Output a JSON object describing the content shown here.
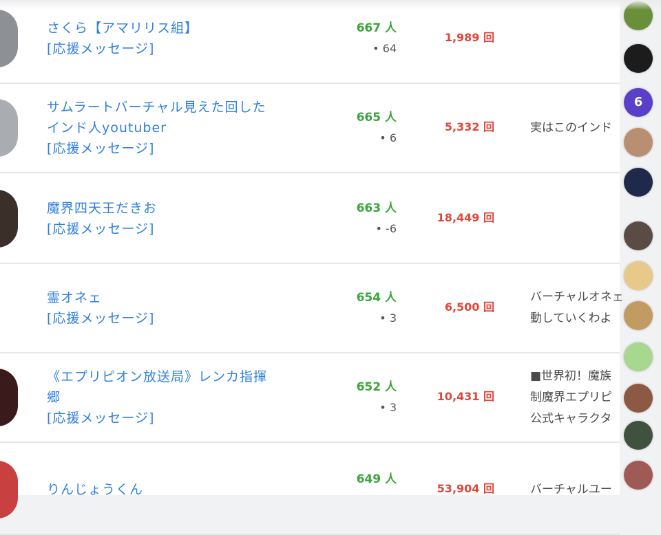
{
  "ranking": {
    "rows": [
      {
        "name_lines": [
          "さくら【アマリリス組】"
        ],
        "support": "[応援メッセージ]",
        "count": "667 人",
        "delta": "• 64",
        "views": "1,989 回",
        "desc_lines": []
      },
      {
        "name_lines": [
          "サムラートバーチャル見えた回した",
          "インド人youtuber"
        ],
        "support": "[応援メッセージ]",
        "count": "665 人",
        "delta": "• 6",
        "views": "5,332 回",
        "desc_lines": [
          "実はこのインド"
        ]
      },
      {
        "name_lines": [
          "魔界四天王だきお"
        ],
        "support": "[応援メッセージ]",
        "count": "663 人",
        "delta": "• -6",
        "views": "18,449 回",
        "desc_lines": []
      },
      {
        "name_lines": [
          "霊オネェ"
        ],
        "support": "[応援メッセージ]",
        "count": "654 人",
        "delta": "• 3",
        "views": "6,500 回",
        "desc_lines": [
          "バーチャルオネェ",
          "動していくわよ"
        ]
      },
      {
        "name_lines": [
          "《エプリピオン放送局》レンカ指揮",
          "郷"
        ],
        "support": "[応援メッセージ]",
        "count": "652 人",
        "delta": "• 3",
        "views": "10,431 回",
        "desc_lines": [
          "■世界初！魔族",
          "制魔界エプリピ",
          "公式キャラクタ"
        ]
      },
      {
        "name_lines": [
          "りんじょうくん"
        ],
        "support": "",
        "count": "649 人",
        "delta": "",
        "views": "53,904 回",
        "desc_lines": [
          "バーチャルユー"
        ]
      }
    ]
  },
  "sidebar": {
    "avatars": [
      {
        "icon": "avatar-icon",
        "color": "#6a8f3a",
        "letter": ""
      },
      {
        "icon": "avatar-icon",
        "color": "#1c1c1c",
        "letter": ""
      },
      {
        "icon": "avatar-icon",
        "color": "#5a3fc8",
        "letter": "6"
      },
      {
        "icon": "avatar-icon",
        "color": "#b98f72",
        "letter": ""
      },
      {
        "icon": "avatar-icon",
        "color": "#1f2a4a",
        "letter": ""
      },
      {
        "icon": "avatar-icon",
        "color": "#5b4b45",
        "letter": ""
      },
      {
        "icon": "avatar-icon",
        "color": "#e8c98a",
        "letter": ""
      },
      {
        "icon": "avatar-icon",
        "color": "#c29b63",
        "letter": ""
      },
      {
        "icon": "avatar-icon",
        "color": "#a8d88f",
        "letter": ""
      },
      {
        "icon": "avatar-icon",
        "color": "#8c5a44",
        "letter": ""
      },
      {
        "icon": "avatar-icon",
        "color": "#40523f",
        "letter": ""
      },
      {
        "icon": "avatar-icon",
        "color": "#a05a55",
        "letter": ""
      }
    ]
  }
}
